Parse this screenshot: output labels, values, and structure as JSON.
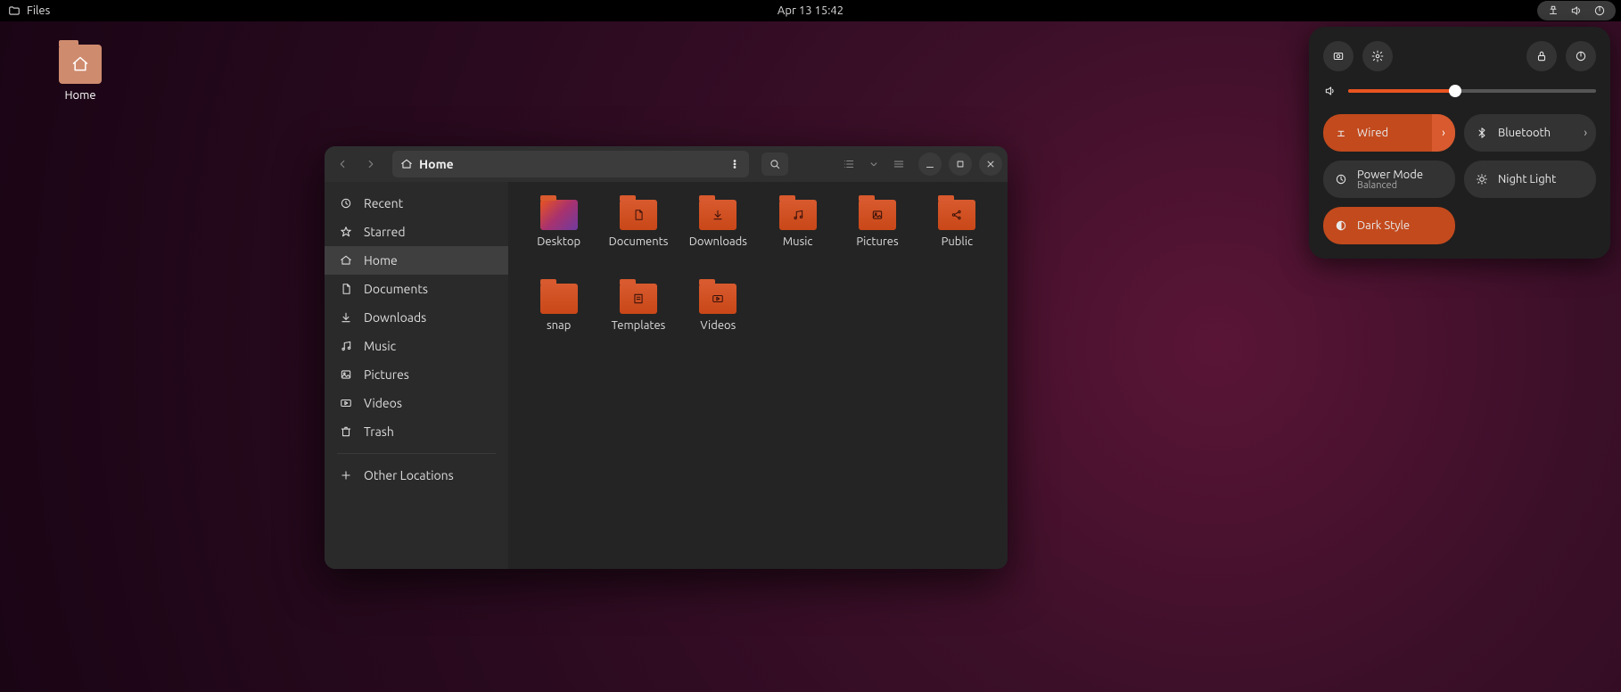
{
  "topbar": {
    "app_label": "Files",
    "datetime": "Apr 13  15:42"
  },
  "desktop": {
    "home_label": "Home"
  },
  "quick_settings": {
    "volume_percent": 43,
    "tiles": {
      "wired": "Wired",
      "bluetooth": "Bluetooth",
      "power_mode": "Power Mode",
      "power_mode_sub": "Balanced",
      "night_light": "Night Light",
      "dark_style": "Dark Style"
    }
  },
  "files_window": {
    "path_label": "Home",
    "sidebar": [
      {
        "label": "Recent",
        "icon": "clock"
      },
      {
        "label": "Starred",
        "icon": "star"
      },
      {
        "label": "Home",
        "icon": "home",
        "active": true
      },
      {
        "label": "Documents",
        "icon": "doc"
      },
      {
        "label": "Downloads",
        "icon": "download"
      },
      {
        "label": "Music",
        "icon": "music"
      },
      {
        "label": "Pictures",
        "icon": "image"
      },
      {
        "label": "Videos",
        "icon": "video"
      },
      {
        "label": "Trash",
        "icon": "trash"
      }
    ],
    "other_locations": "Other Locations",
    "folders": [
      {
        "label": "Desktop",
        "glyph": "desktop"
      },
      {
        "label": "Documents",
        "glyph": "doc"
      },
      {
        "label": "Downloads",
        "glyph": "download"
      },
      {
        "label": "Music",
        "glyph": "music"
      },
      {
        "label": "Pictures",
        "glyph": "image"
      },
      {
        "label": "Public",
        "glyph": "share"
      },
      {
        "label": "snap",
        "glyph": "none"
      },
      {
        "label": "Templates",
        "glyph": "template"
      },
      {
        "label": "Videos",
        "glyph": "video"
      }
    ]
  }
}
